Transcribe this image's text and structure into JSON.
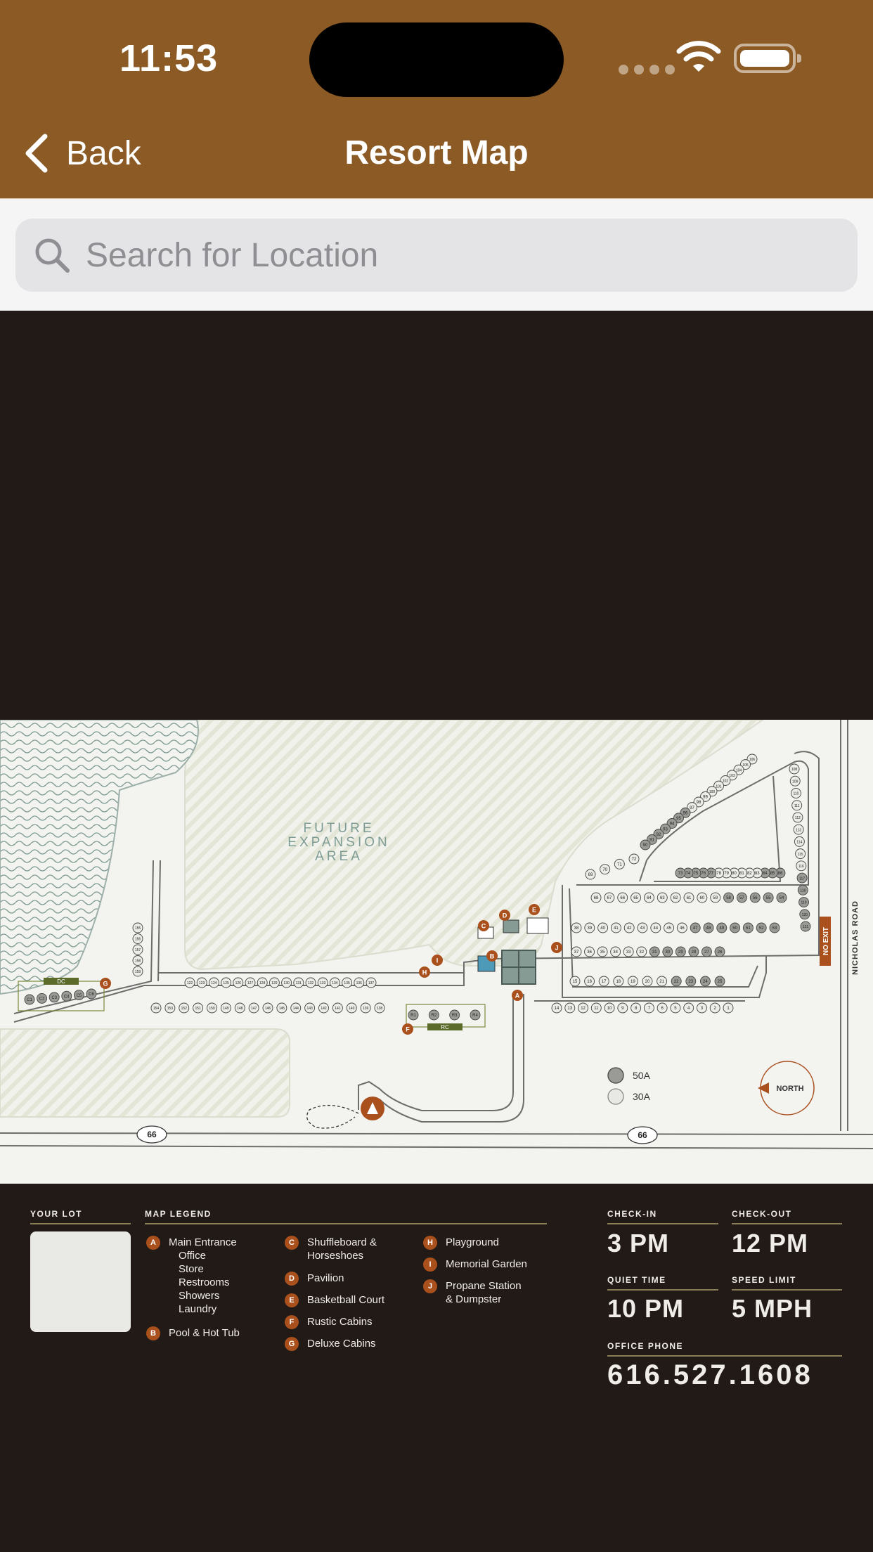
{
  "status": {
    "time": "11:53"
  },
  "nav": {
    "back_label": "Back",
    "title": "Resort Map"
  },
  "search": {
    "placeholder": "Search for Location",
    "value": ""
  },
  "map": {
    "expansion_label": [
      "FUTURE",
      "EXPANSION",
      "AREA"
    ],
    "road_label": "NICHOLAS ROAD",
    "no_exit": "NO EXIT",
    "highway": "66",
    "north": "NORTH",
    "amp_50": "50A",
    "amp_30": "30A",
    "dc_label": "DC",
    "rc_label": "RC",
    "sites_row_1": [
      "106",
      "105",
      "104",
      "103",
      "102",
      "101",
      "100",
      "99",
      "98",
      "97",
      "96",
      "95",
      "94",
      "93",
      "92",
      "91",
      "90"
    ],
    "sites_row_main": [
      "68",
      "67",
      "66",
      "65",
      "64",
      "63",
      "62",
      "61",
      "60",
      "59",
      "58",
      "57",
      "56",
      "55",
      "54"
    ],
    "sites_row_2": [
      "38",
      "39",
      "40",
      "41",
      "42",
      "43",
      "44",
      "45",
      "46",
      "47",
      "48",
      "49",
      "50",
      "51",
      "52",
      "53"
    ],
    "sites_row_3": [
      "37",
      "36",
      "35",
      "34",
      "33",
      "32",
      "31",
      "30",
      "29",
      "28",
      "27",
      "26"
    ],
    "sites_row_4": [
      "15",
      "16",
      "17",
      "18",
      "19",
      "20",
      "21",
      "22",
      "23",
      "24",
      "25"
    ],
    "sites_row_5": [
      "14",
      "13",
      "12",
      "11",
      "10",
      "9",
      "8",
      "7",
      "6",
      "5",
      "4",
      "3",
      "2",
      "1"
    ],
    "sites_right": [
      "86",
      "85",
      "84",
      "83",
      "82",
      "81",
      "80",
      "79",
      "78",
      "77",
      "76",
      "75",
      "74",
      "73"
    ],
    "sites_top": [
      "69",
      "70",
      "71",
      "72"
    ],
    "sites_far_right": [
      "108",
      "109",
      "110",
      "111",
      "112",
      "113",
      "114",
      "115",
      "116",
      "117",
      "118",
      "119",
      "120",
      "121"
    ],
    "sites_loop_top": [
      "137",
      "136",
      "135",
      "134",
      "133",
      "132",
      "131",
      "130",
      "129",
      "128",
      "127",
      "126",
      "125",
      "124",
      "123",
      "122"
    ],
    "sites_loop_bottom": [
      "138",
      "139",
      "140",
      "141",
      "142",
      "143",
      "144",
      "145",
      "146",
      "147",
      "148",
      "149",
      "150",
      "151",
      "152",
      "153",
      "154"
    ],
    "sites_left_col": [
      "159",
      "158",
      "157",
      "156",
      "155"
    ],
    "cabins_c": [
      "C1",
      "C2",
      "C3",
      "C4",
      "C5",
      "C6"
    ],
    "cabins_r": [
      "R1",
      "R2",
      "R3",
      "R4"
    ]
  },
  "legend": {
    "your_lot": "YOUR LOT",
    "map_legend": "MAP LEGEND",
    "items": [
      {
        "key": "A",
        "label": "Main Entrance",
        "sub": [
          "Office",
          "Store",
          "Restrooms",
          "Showers",
          "Laundry"
        ]
      },
      {
        "key": "B",
        "label": "Pool & Hot Tub"
      },
      {
        "key": "C",
        "label": "Shuffleboard &",
        "label2": "Horseshoes"
      },
      {
        "key": "D",
        "label": "Pavilion"
      },
      {
        "key": "E",
        "label": "Basketball Court"
      },
      {
        "key": "F",
        "label": "Rustic Cabins"
      },
      {
        "key": "G",
        "label": "Deluxe Cabins"
      },
      {
        "key": "H",
        "label": "Playground"
      },
      {
        "key": "I",
        "label": "Memorial Garden"
      },
      {
        "key": "J",
        "label": "Propane Station",
        "label2": "& Dumpster"
      }
    ],
    "check_in_label": "CHECK-IN",
    "check_in": "3 PM",
    "check_out_label": "CHECK-OUT",
    "check_out": "12 PM",
    "quiet_label": "QUIET TIME",
    "quiet": "10 PM",
    "speed_label": "SPEED LIMIT",
    "speed": "5 MPH",
    "phone_label": "OFFICE PHONE",
    "phone": "616.527.1608"
  },
  "colors": {
    "header": "#8c5a24",
    "accent": "#a9501d",
    "dark": "#221a17",
    "map_bg": "#f3f3f0"
  }
}
